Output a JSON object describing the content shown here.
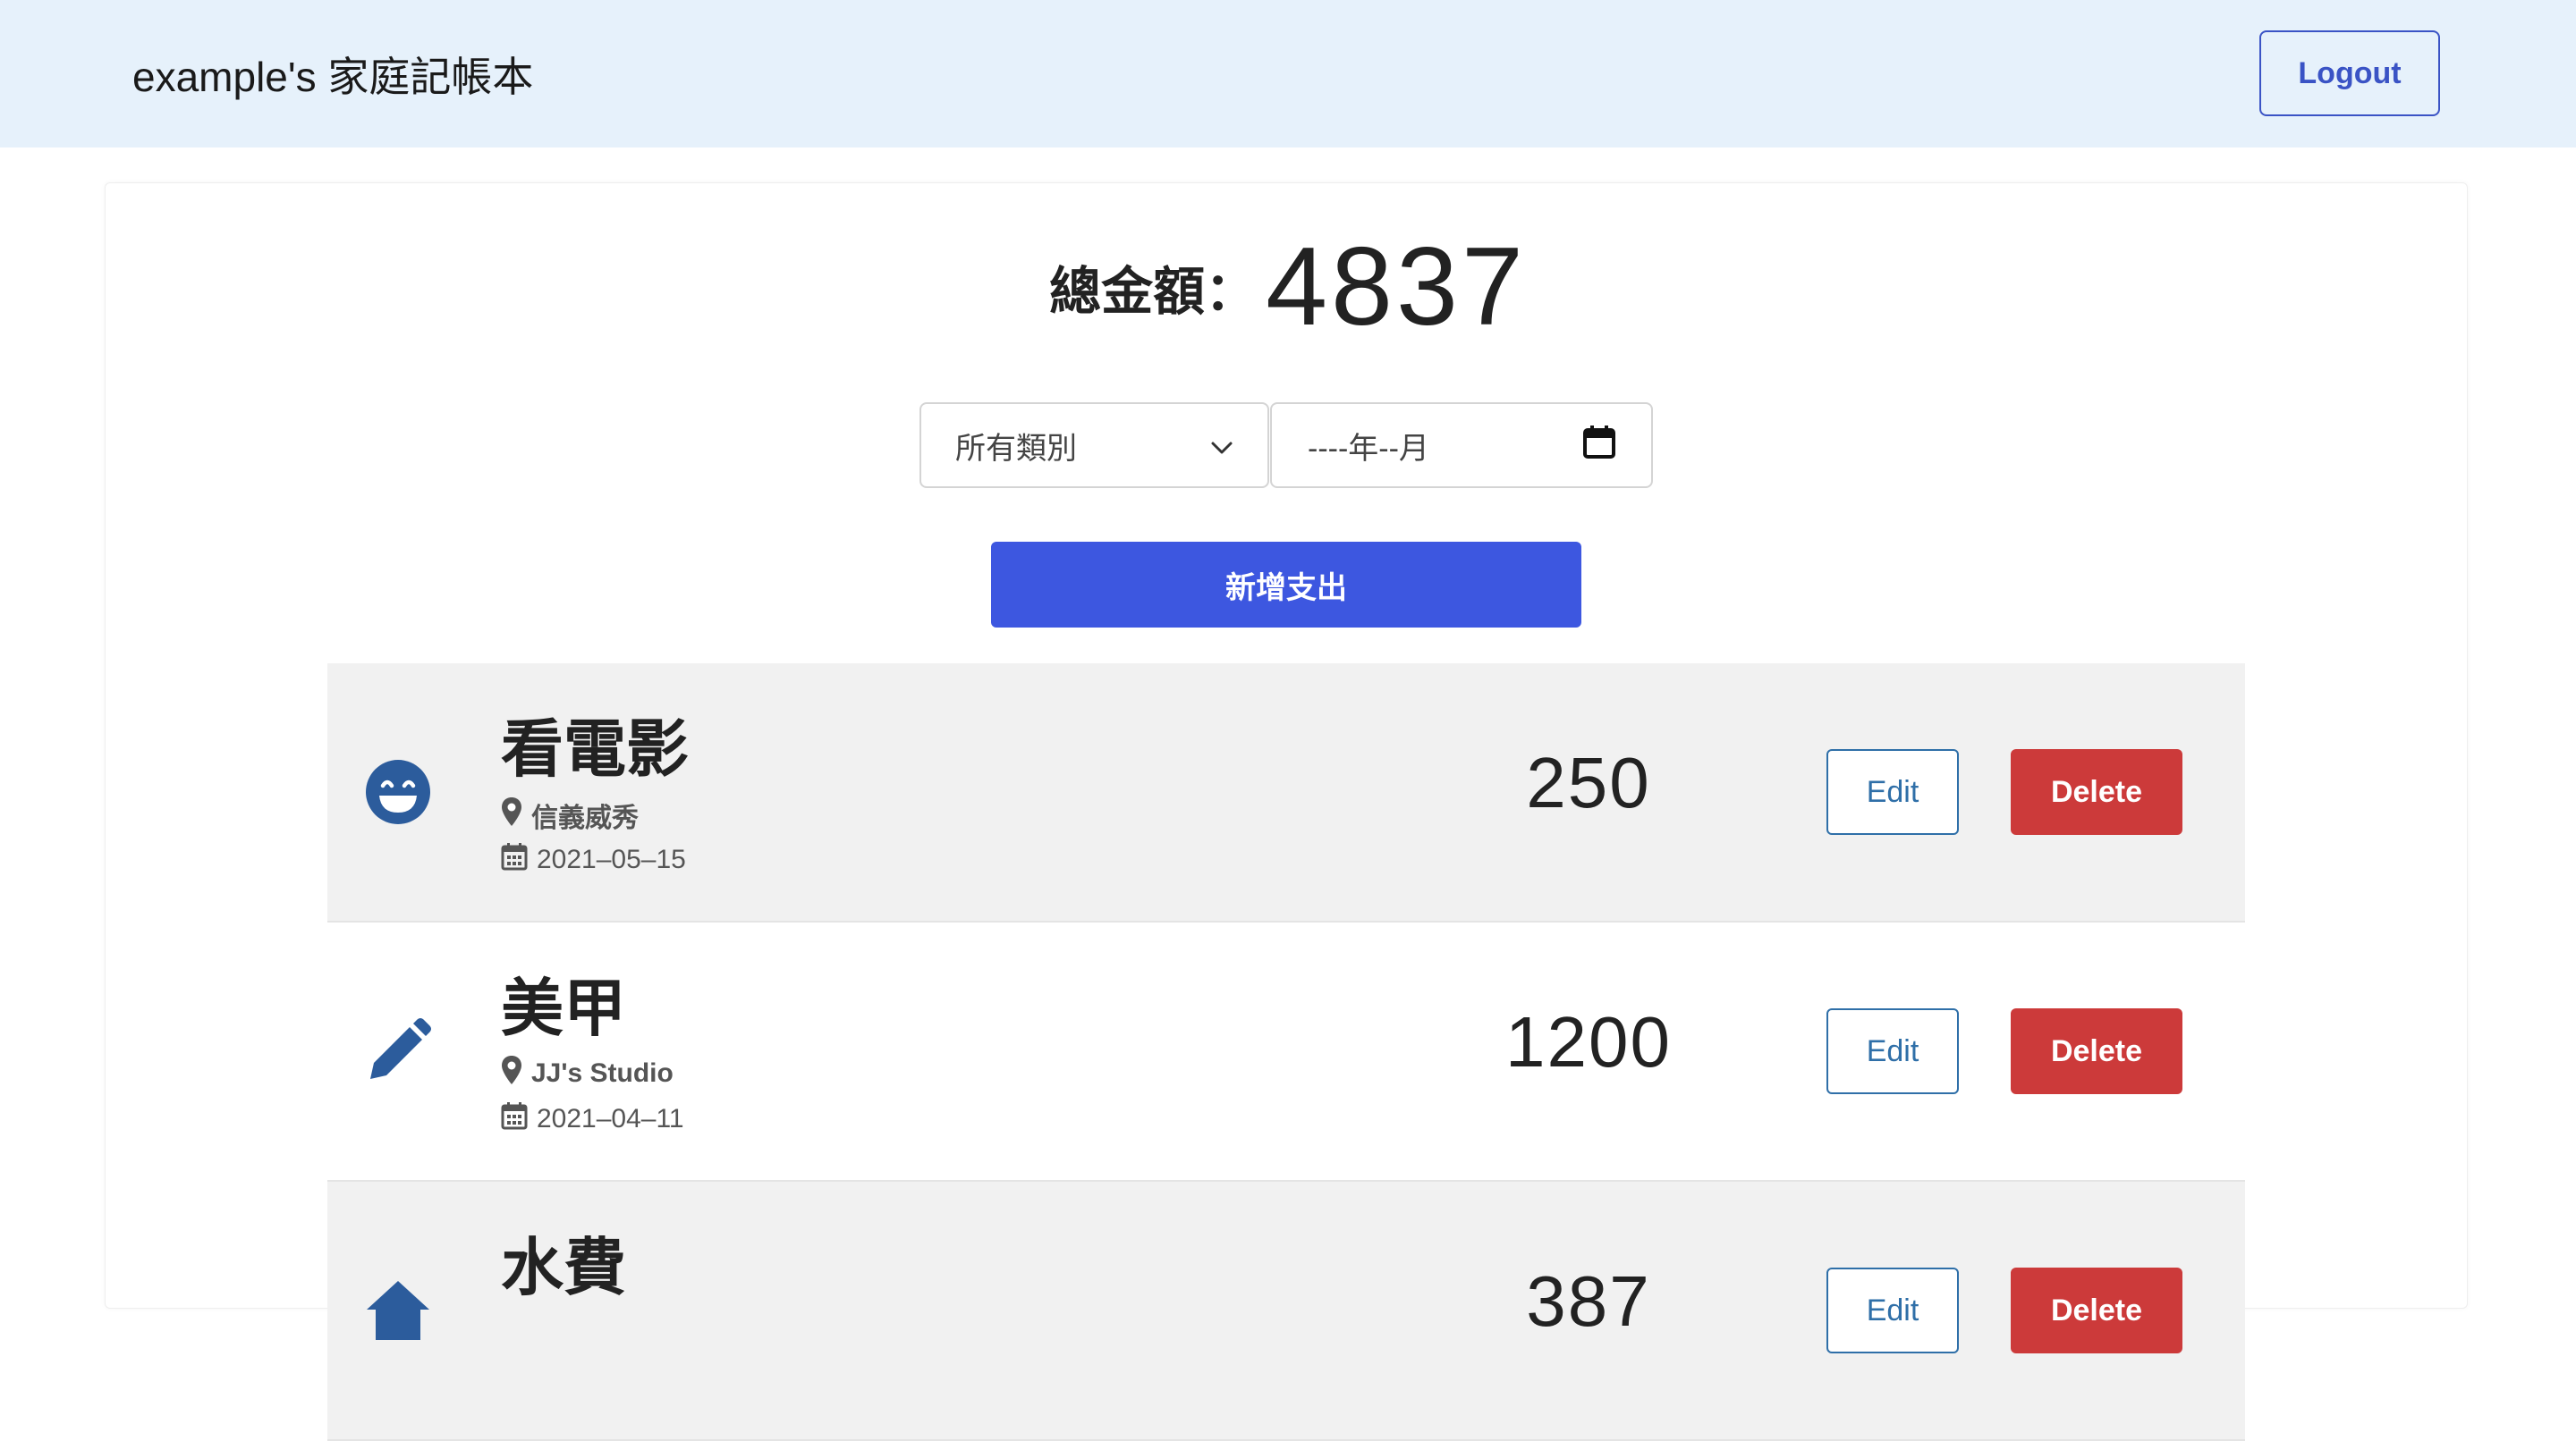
{
  "navbar": {
    "brand": "example's 家庭記帳本",
    "logout_label": "Logout"
  },
  "summary": {
    "label": "總金額：",
    "total": "4837"
  },
  "filters": {
    "category_selected": "所有類別",
    "month_placeholder": "----年--月"
  },
  "add_button_label": "新增支出",
  "colors": {
    "primary": "#3d57e0",
    "danger": "#cc3a3a",
    "icon_blue": "#2c5c9c",
    "navbar_bg": "#e6f1fb"
  },
  "expenses": [
    {
      "title": "看電影",
      "icon": "laugh-icon",
      "location": "信義威秀",
      "date": "2021–05–15",
      "amount": "250",
      "edit_label": "Edit",
      "delete_label": "Delete"
    },
    {
      "title": "美甲",
      "icon": "pencil-icon",
      "location": "JJ's Studio",
      "date": "2021–04–11",
      "amount": "1200",
      "edit_label": "Edit",
      "delete_label": "Delete"
    },
    {
      "title": "水費",
      "icon": "home-icon",
      "location": "",
      "date": "",
      "amount": "387",
      "edit_label": "Edit",
      "delete_label": "Delete"
    }
  ]
}
